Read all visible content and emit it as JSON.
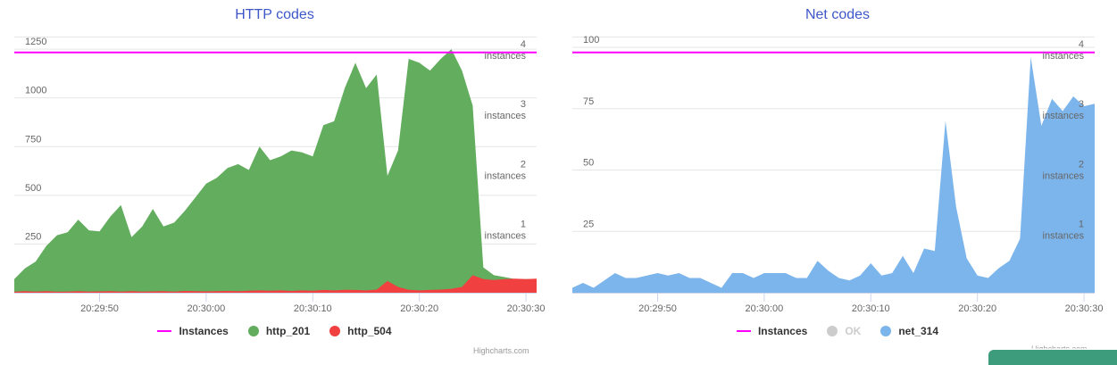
{
  "chart_data": [
    {
      "type": "area",
      "title": "HTTP codes",
      "x": [
        "20:29:42",
        "20:29:43",
        "20:29:44",
        "20:29:45",
        "20:29:46",
        "20:29:47",
        "20:29:48",
        "20:29:49",
        "20:29:50",
        "20:29:51",
        "20:29:52",
        "20:29:53",
        "20:29:54",
        "20:29:55",
        "20:29:56",
        "20:29:57",
        "20:29:58",
        "20:29:59",
        "20:30:00",
        "20:30:01",
        "20:30:02",
        "20:30:03",
        "20:30:04",
        "20:30:05",
        "20:30:06",
        "20:30:07",
        "20:30:08",
        "20:30:09",
        "20:30:10",
        "20:30:11",
        "20:30:12",
        "20:30:13",
        "20:30:14",
        "20:30:15",
        "20:30:16",
        "20:30:17",
        "20:30:18",
        "20:30:19",
        "20:30:20",
        "20:30:21",
        "20:30:22",
        "20:30:23",
        "20:30:24",
        "20:30:25",
        "20:30:26",
        "20:30:27",
        "20:30:28",
        "20:30:29",
        "20:30:30",
        "20:30:31"
      ],
      "x_ticks": [
        "20:29:50",
        "20:30:00",
        "20:30:10",
        "20:30:20",
        "20:30:30"
      ],
      "y_ticks": [
        "250",
        "500",
        "750",
        "1000",
        "1250"
      ],
      "ylim": [
        0,
        1310
      ],
      "instances_axis": {
        "ticks": [
          "1",
          "2",
          "3",
          "4"
        ],
        "label": "instances",
        "max": 4.25
      },
      "series": [
        {
          "name": "Instances",
          "kind": "line",
          "axis": "instances",
          "color": "#FF00FF",
          "values": [
            4,
            4,
            4,
            4,
            4,
            4,
            4,
            4,
            4,
            4,
            4,
            4,
            4,
            4,
            4,
            4,
            4,
            4,
            4,
            4,
            4,
            4,
            4,
            4,
            4,
            4,
            4,
            4,
            4,
            4,
            4,
            4,
            4,
            4,
            4,
            4,
            4,
            4,
            4,
            4,
            4,
            4,
            4,
            4,
            4,
            4,
            4,
            4,
            4,
            4
          ]
        },
        {
          "name": "http_201",
          "kind": "area",
          "color": "#63AD5E",
          "values": [
            70,
            125,
            160,
            240,
            295,
            310,
            375,
            320,
            315,
            390,
            450,
            285,
            340,
            430,
            340,
            360,
            420,
            490,
            560,
            590,
            640,
            660,
            630,
            750,
            680,
            700,
            730,
            720,
            700,
            860,
            880,
            1050,
            1180,
            1050,
            1120,
            600,
            730,
            1200,
            1180,
            1140,
            1200,
            1250,
            1140,
            960,
            130,
            90,
            80,
            70,
            70,
            70
          ]
        },
        {
          "name": "http_504",
          "kind": "area",
          "color": "#F04040",
          "values": [
            5,
            8,
            6,
            8,
            5,
            6,
            8,
            6,
            7,
            8,
            6,
            8,
            6,
            7,
            8,
            6,
            9,
            8,
            7,
            8,
            9,
            8,
            10,
            12,
            10,
            12,
            9,
            12,
            10,
            14,
            12,
            15,
            14,
            12,
            16,
            60,
            30,
            15,
            12,
            14,
            16,
            20,
            30,
            90,
            70,
            65,
            70,
            72,
            70,
            72
          ]
        }
      ]
    },
    {
      "type": "area",
      "title": "Net codes",
      "x": [
        "20:29:42",
        "20:29:43",
        "20:29:44",
        "20:29:45",
        "20:29:46",
        "20:29:47",
        "20:29:48",
        "20:29:49",
        "20:29:50",
        "20:29:51",
        "20:29:52",
        "20:29:53",
        "20:29:54",
        "20:29:55",
        "20:29:56",
        "20:29:57",
        "20:29:58",
        "20:29:59",
        "20:30:00",
        "20:30:01",
        "20:30:02",
        "20:30:03",
        "20:30:04",
        "20:30:05",
        "20:30:06",
        "20:30:07",
        "20:30:08",
        "20:30:09",
        "20:30:10",
        "20:30:11",
        "20:30:12",
        "20:30:13",
        "20:30:14",
        "20:30:15",
        "20:30:16",
        "20:30:17",
        "20:30:18",
        "20:30:19",
        "20:30:20",
        "20:30:21",
        "20:30:22",
        "20:30:23",
        "20:30:24",
        "20:30:25",
        "20:30:26",
        "20:30:27",
        "20:30:28",
        "20:30:29",
        "20:30:30",
        "20:30:31"
      ],
      "x_ticks": [
        "20:29:50",
        "20:30:00",
        "20:30:10",
        "20:30:20",
        "20:30:30"
      ],
      "y_ticks": [
        "25",
        "50",
        "75",
        "100"
      ],
      "ylim": [
        0,
        104
      ],
      "instances_axis": {
        "ticks": [
          "1",
          "2",
          "3",
          "4"
        ],
        "label": "instances",
        "max": 4.25
      },
      "series": [
        {
          "name": "Instances",
          "kind": "line",
          "axis": "instances",
          "color": "#FF00FF",
          "values": [
            4,
            4,
            4,
            4,
            4,
            4,
            4,
            4,
            4,
            4,
            4,
            4,
            4,
            4,
            4,
            4,
            4,
            4,
            4,
            4,
            4,
            4,
            4,
            4,
            4,
            4,
            4,
            4,
            4,
            4,
            4,
            4,
            4,
            4,
            4,
            4,
            4,
            4,
            4,
            4,
            4,
            4,
            4,
            4,
            4,
            4,
            4,
            4,
            4,
            4
          ]
        },
        {
          "name": "OK",
          "kind": "area",
          "color": "#CCCCCC",
          "hidden": true,
          "values": []
        },
        {
          "name": "net_314",
          "kind": "area",
          "color": "#7CB5EC",
          "values": [
            2,
            4,
            2,
            5,
            8,
            6,
            6,
            7,
            8,
            7,
            8,
            6,
            6,
            4,
            2,
            8,
            8,
            6,
            8,
            8,
            8,
            6,
            6,
            13,
            9,
            6,
            5,
            7,
            12,
            7,
            8,
            15,
            8,
            18,
            17,
            70,
            35,
            14,
            7,
            6,
            10,
            13,
            22,
            96,
            68,
            79,
            74,
            80,
            76,
            77
          ]
        }
      ]
    }
  ],
  "legend_http": [
    "Instances",
    "http_201",
    "http_504"
  ],
  "legend_net": [
    "Instances",
    "OK",
    "net_314"
  ],
  "credits": "Highcharts.com"
}
